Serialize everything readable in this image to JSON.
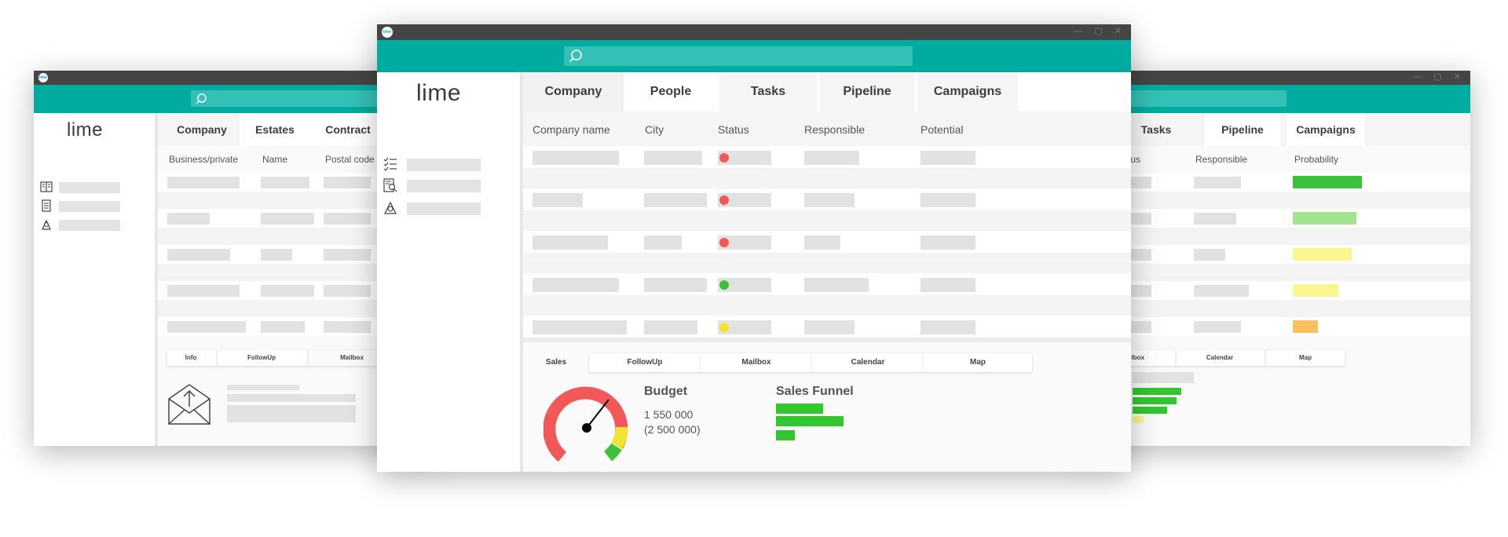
{
  "app": {
    "icon_text": "lime",
    "window_controls": "— ▢ ✕"
  },
  "left_window": {
    "logo": "lime",
    "tabs": [
      "Company",
      "Estates",
      "Contract"
    ],
    "columns": [
      "Business/private",
      "Name",
      "Postal code"
    ],
    "bottom_tabs": [
      "Info",
      "FollowUp",
      "Mailbox"
    ],
    "nav_icons": [
      "book-icon",
      "document-icon",
      "campaign-icon"
    ]
  },
  "center_window": {
    "logo": "lime",
    "tabs": [
      "Company",
      "People",
      "Tasks",
      "Pipeline",
      "Campaigns"
    ],
    "columns": [
      "Company name",
      "City",
      "Status",
      "Responsible",
      "Potential"
    ],
    "status_colors": [
      "#f25858",
      "#f25858",
      "#f25858",
      "#3cc23a",
      "#f2e433"
    ],
    "bottom_tabs": [
      "Sales",
      "FollowUp",
      "Mailbox",
      "Calendar",
      "Map"
    ],
    "budget": {
      "title": "Budget",
      "value": "1 550 000",
      "target": "(2 500 000)"
    },
    "funnel": {
      "title": "Sales Funnel"
    },
    "nav_icons": [
      "checklist-icon",
      "contact-search-icon",
      "campaign-icon"
    ]
  },
  "right_window": {
    "tabs": [
      "Tasks",
      "Pipeline",
      "Campaigns"
    ],
    "columns": [
      "Status",
      "Responsible",
      "Probability"
    ],
    "bottom_tabs": [
      "Mailbox",
      "Calendar",
      "Map"
    ],
    "probability_levels": [
      1.0,
      0.92,
      0.85,
      0.66,
      0.36
    ],
    "probability_colors": [
      "#3cc23a",
      "#a2e590",
      "#faf78e",
      "#faf78e",
      "#fbbf5f"
    ]
  },
  "colors": {
    "brand_teal": "#00ab9f",
    "title_bar": "#454545"
  }
}
